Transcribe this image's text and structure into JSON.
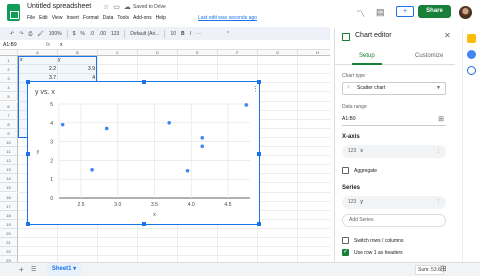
{
  "header": {
    "doc_title": "Untitled spreadsheet",
    "saved_text": "Saved to Drive",
    "menu": [
      "File",
      "Edit",
      "View",
      "Insert",
      "Format",
      "Data",
      "Tools",
      "Add-ons",
      "Help"
    ],
    "last_edit": "Last edit was seconds ago",
    "share_label": "Share"
  },
  "toolbar": {
    "zoom": "100%",
    "currency": "$",
    "percent": "%",
    "decimals": ".0",
    "more_decimals": ".00",
    "format_123": "123",
    "font": "Default (Ari...",
    "font_size": "10"
  },
  "formula_bar": {
    "cell_ref": "A1:B9",
    "fx": "fx",
    "value": "x"
  },
  "grid": {
    "columns": [
      "A",
      "B",
      "C",
      "D",
      "E",
      "F",
      "G",
      "H"
    ],
    "rows": [
      "1",
      "2",
      "3",
      "4",
      "5",
      "6",
      "7",
      "8",
      "9",
      "10",
      "11",
      "12",
      "13",
      "14",
      "15",
      "16",
      "17",
      "18",
      "19",
      "20",
      "21",
      "22",
      "23"
    ],
    "cells": [
      {
        "row": 1,
        "col": 0,
        "text": "x"
      },
      {
        "row": 1,
        "col": 1,
        "text": "y"
      },
      {
        "row": 2,
        "col": 0,
        "text": "2.2"
      },
      {
        "row": 2,
        "col": 1,
        "text": "3.9"
      },
      {
        "row": 3,
        "col": 0,
        "text": "3.7"
      },
      {
        "row": 3,
        "col": 1,
        "text": "4"
      }
    ]
  },
  "chart_data": {
    "type": "scatter",
    "title": "y vs. x",
    "xlabel": "x",
    "ylabel": "y",
    "xlim": [
      2.2,
      4.8
    ],
    "ylim": [
      0,
      5
    ],
    "xticks": [
      "2.5",
      "3.0",
      "3.5",
      "4.0",
      "4.5"
    ],
    "yticks": [
      "0",
      "1",
      "2",
      "3",
      "4",
      "5"
    ],
    "grid": true,
    "color": "#4285f4",
    "points": [
      {
        "x": 2.25,
        "y": 3.9
      },
      {
        "x": 2.65,
        "y": 1.5
      },
      {
        "x": 2.85,
        "y": 3.7
      },
      {
        "x": 3.7,
        "y": 4.0
      },
      {
        "x": 3.95,
        "y": 1.45
      },
      {
        "x": 4.15,
        "y": 3.2
      },
      {
        "x": 4.15,
        "y": 2.75
      },
      {
        "x": 4.75,
        "y": 4.95
      }
    ]
  },
  "bottom": {
    "sheet_name": "Sheet1",
    "sum_label": "Sum: 53.6"
  },
  "panel": {
    "title": "Chart editor",
    "tab_setup": "Setup",
    "tab_customize": "Customize",
    "chart_type_label": "Chart type",
    "chart_type_value": "Scatter chart",
    "data_range_label": "Data range",
    "data_range_value": "A1:B9",
    "xaxis_label": "X-axis",
    "xaxis_value": "x",
    "aggregate_label": "Aggregate",
    "series_label": "Series",
    "series_value": "y",
    "add_series_label": "Add Series",
    "switch_label": "Switch rows / columns",
    "use_row_label": "Use row 1 as headers"
  }
}
